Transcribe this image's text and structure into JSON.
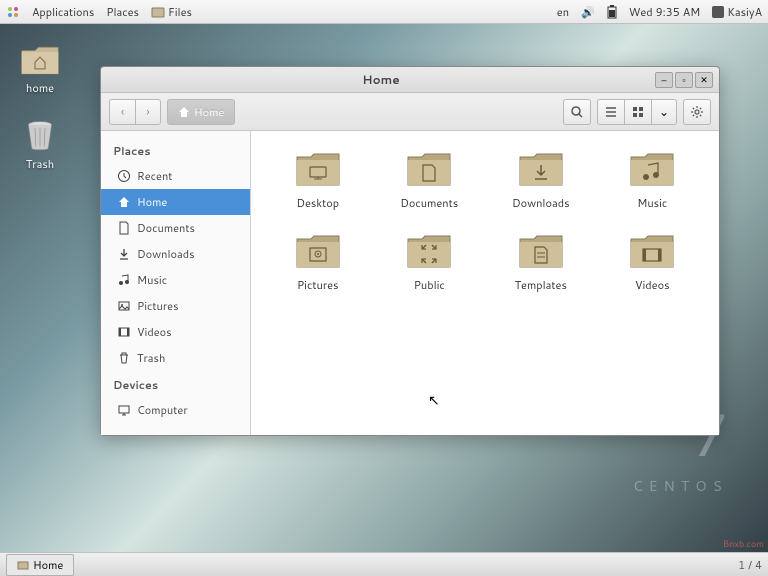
{
  "topbar": {
    "applications": "Applications",
    "places": "Places",
    "files": "Files",
    "lang": "en",
    "datetime": "Wed  9:35 AM",
    "user": "KasiyA"
  },
  "desktop": {
    "home": "home",
    "trash": "Trash"
  },
  "brand": {
    "version": "7",
    "name": "CENTOS"
  },
  "taskbar": {
    "item": "Home",
    "workspaces": "1 / 4"
  },
  "watermark": "Bnxb.com",
  "fm": {
    "title": "Home",
    "path": "Home",
    "sidebar": {
      "places_heading": "Places",
      "devices_heading": "Devices",
      "places": [
        {
          "label": "Recent",
          "icon": "clock-icon"
        },
        {
          "label": "Home",
          "icon": "home-icon"
        },
        {
          "label": "Documents",
          "icon": "document-icon"
        },
        {
          "label": "Downloads",
          "icon": "download-icon"
        },
        {
          "label": "Music",
          "icon": "music-icon"
        },
        {
          "label": "Pictures",
          "icon": "picture-icon"
        },
        {
          "label": "Videos",
          "icon": "video-icon"
        },
        {
          "label": "Trash",
          "icon": "trash-icon"
        }
      ],
      "devices": [
        {
          "label": "Computer",
          "icon": "computer-icon"
        }
      ]
    },
    "folders": [
      {
        "label": "Desktop",
        "glyph": "desktop"
      },
      {
        "label": "Documents",
        "glyph": "document"
      },
      {
        "label": "Downloads",
        "glyph": "download"
      },
      {
        "label": "Music",
        "glyph": "music"
      },
      {
        "label": "Pictures",
        "glyph": "picture"
      },
      {
        "label": "Public",
        "glyph": "public"
      },
      {
        "label": "Templates",
        "glyph": "template"
      },
      {
        "label": "Videos",
        "glyph": "video"
      }
    ]
  }
}
